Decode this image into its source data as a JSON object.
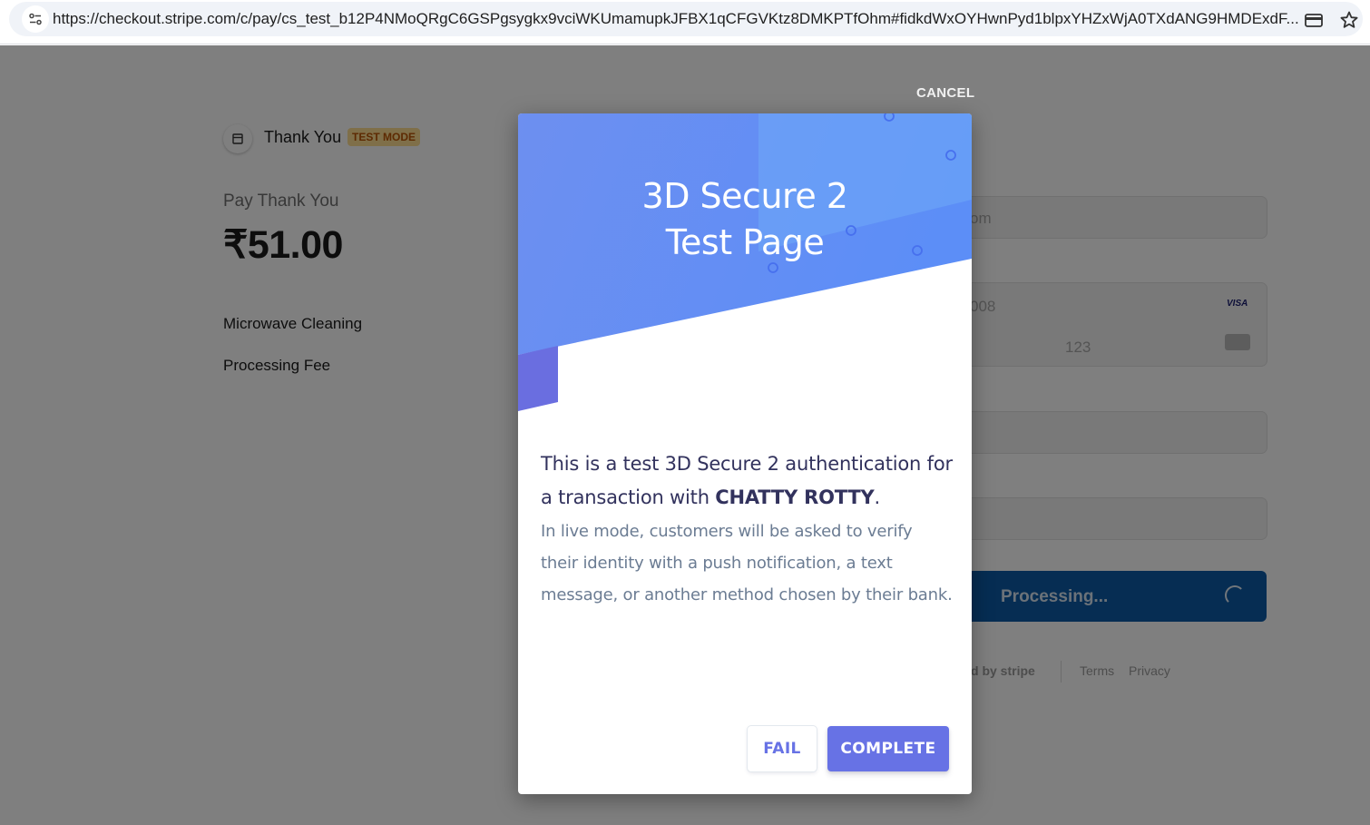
{
  "browser": {
    "url": "https://checkout.stripe.com/c/pay/cs_test_b12P4NMoQRgC6GSPgsygkx9vciWKUmamupkJFBX1qCFGVKtz8DMKPTfOhm#fidkdWxOYHwnPyd1blpxYHZxWjA0TXdANG9HMDExdF..."
  },
  "checkout": {
    "brand_name": "Thank You",
    "test_mode_badge": "TEST MODE",
    "pay_label": "Pay Thank You",
    "amount": "₹51.00",
    "line_items": [
      "Microwave Cleaning",
      "Processing Fee"
    ],
    "email_fragment": "om",
    "card_number_fragment": "008",
    "card_brand": "VISA",
    "cvc_value": "123",
    "pay_button_label": "Processing...",
    "footer_powered": "d by stripe",
    "footer_terms": "Terms",
    "footer_privacy": "Privacy"
  },
  "overlay": {
    "cancel_label": "CANCEL"
  },
  "modal": {
    "title_line1": "3D Secure 2",
    "title_line2": "Test Page",
    "lead_text": "This is a test 3D Secure 2 authentication for a transaction with ",
    "merchant_name": "CHATTY ROTTY",
    "lead_end": ".",
    "sub_text": "In live mode, customers will be asked to verify their identity with a push notification, a text message, or another method chosen by their bank.",
    "fail_label": "FAIL",
    "complete_label": "COMPLETE"
  },
  "colors": {
    "accent": "#6772e5",
    "hero_blue": "#6b9bf5",
    "pay_button": "#0c5aa6",
    "overlay": "rgba(0,0,0,0.5)"
  },
  "icons": [
    "site-info-icon",
    "credit-card-icon",
    "star-bookmark-icon",
    "store-icon",
    "cvc-card-icon",
    "spinner-icon"
  ]
}
